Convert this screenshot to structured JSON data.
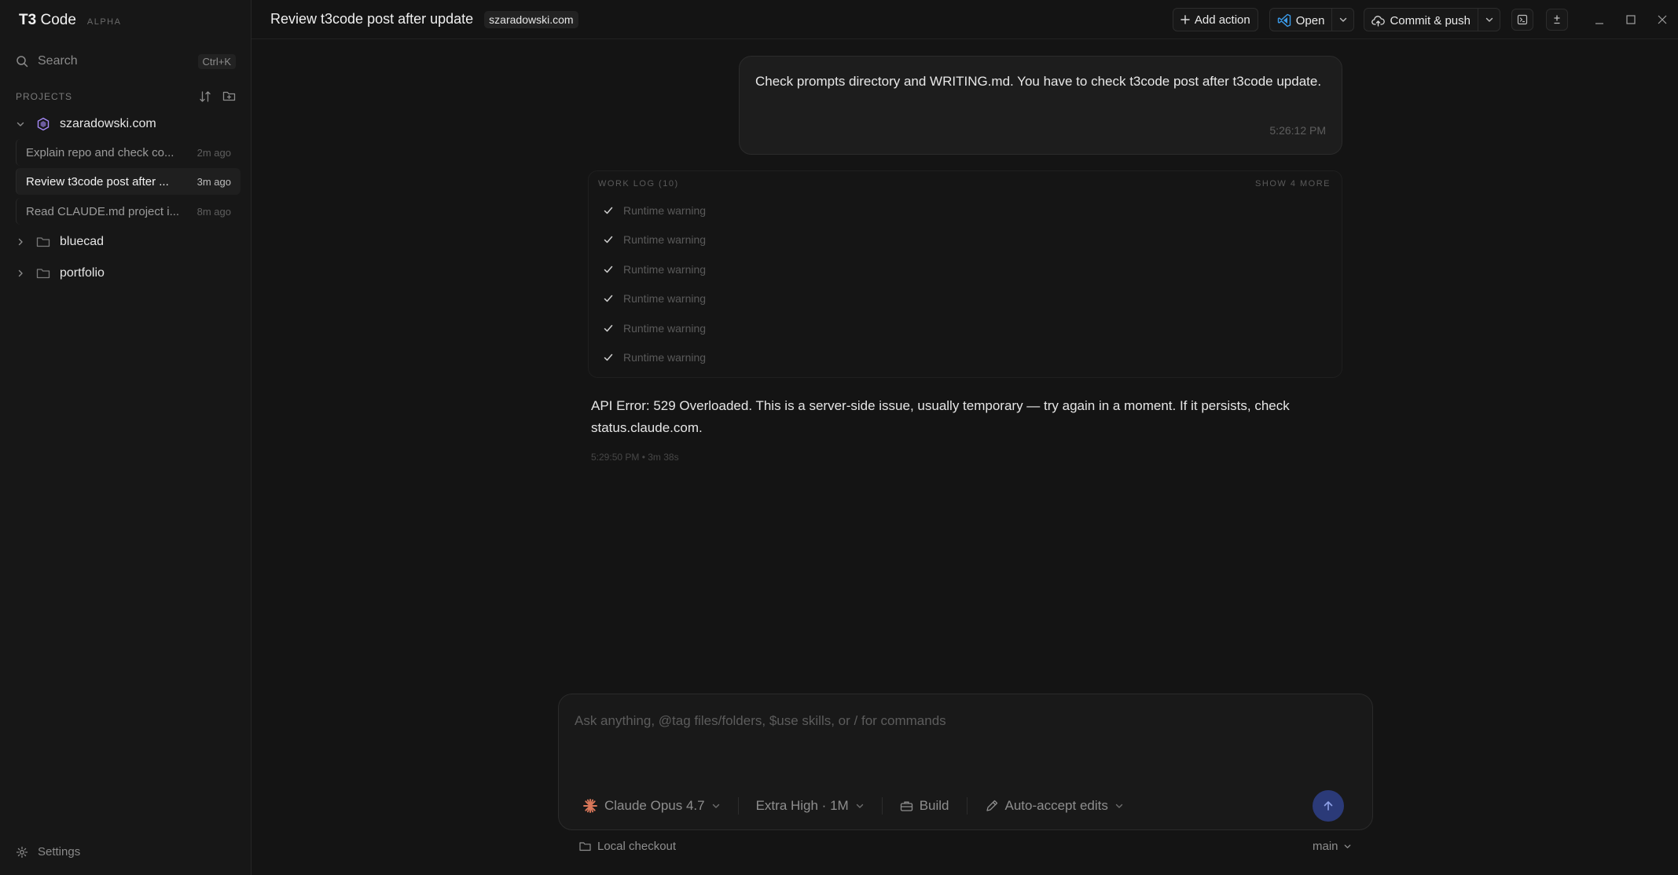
{
  "brand": {
    "name": "T3",
    "name_suffix": " Code",
    "badge": "ALPHA"
  },
  "search": {
    "label": "Search",
    "shortcut": "Ctrl+K"
  },
  "sidebar": {
    "projects_label": "PROJECTS",
    "projects": [
      {
        "name": "szaradowski.com",
        "expanded": true,
        "threads": [
          {
            "title": "Explain repo and check co...",
            "time": "2m ago"
          },
          {
            "title": "Review t3code post after ...",
            "time": "3m ago",
            "active": true
          },
          {
            "title": "Read CLAUDE.md project i...",
            "time": "8m ago"
          }
        ]
      },
      {
        "name": "bluecad",
        "expanded": false
      },
      {
        "name": "portfolio",
        "expanded": false
      }
    ],
    "settings_label": "Settings"
  },
  "topbar": {
    "title": "Review t3code post after update",
    "project_badge": "szaradowski.com",
    "add_action_label": "Add action",
    "open_label": "Open",
    "commit_label": "Commit & push"
  },
  "conversation": {
    "user_message": {
      "text": "Check prompts directory and WRITING.md. You have to check t3code post after t3code update.",
      "time": "5:26:12 PM"
    },
    "work_log": {
      "title": "WORK LOG (10)",
      "show_more": "SHOW 4 MORE",
      "items": [
        "Runtime warning",
        "Runtime warning",
        "Runtime warning",
        "Runtime warning",
        "Runtime warning",
        "Runtime warning"
      ]
    },
    "assistant": {
      "text": "API Error: 529 Overloaded. This is a server-side issue, usually temporary — try again in a moment. If it persists, check status.claude.com.",
      "meta": "5:29:50 PM • 3m 38s"
    }
  },
  "composer": {
    "placeholder": "Ask anything, @tag files/folders, $use skills, or / for commands",
    "model": "Claude Opus 4.7",
    "effort": "Extra High · 1M",
    "mode": "Build",
    "edits": "Auto-accept edits"
  },
  "footer": {
    "checkout": "Local checkout",
    "branch": "main"
  },
  "colors": {
    "accent": "#2b3a78",
    "project_icon": "#a78bfa",
    "background": "#141414"
  }
}
